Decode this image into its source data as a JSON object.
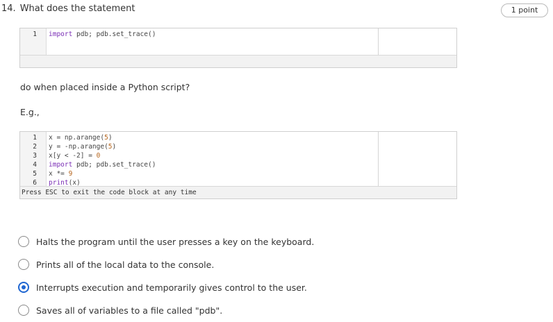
{
  "question": {
    "number": "14.",
    "prompt": "What does the statement",
    "points": "1 point",
    "after_code_text": "do when placed inside a Python script?",
    "example_label": "E.g.,"
  },
  "snippet_one": {
    "lines": [
      {
        "num": "1",
        "kw": "import",
        "rest": " pdb; pdb.set_trace()"
      }
    ]
  },
  "snippet_two": {
    "lines": [
      {
        "num": "1",
        "a": "x = np.arange(",
        "n": "5",
        "b": ")"
      },
      {
        "num": "2",
        "a": "y = -np.arange(",
        "n": "5",
        "b": ")"
      },
      {
        "num": "3",
        "a": "x[y < -2] = ",
        "n": "0",
        "b": ""
      },
      {
        "num": "4",
        "kw": "import",
        "rest": " pdb; pdb.set_trace()"
      },
      {
        "num": "5",
        "a": "x *= ",
        "n": "9",
        "b": ""
      },
      {
        "num": "6",
        "fn": "print",
        "rest": "(x)"
      }
    ],
    "footer": "Press ESC to exit the code block at any time"
  },
  "options": [
    {
      "label": "Halts the program until the user presses a key on the keyboard.",
      "selected": false
    },
    {
      "label": "Prints all of the local data to the console.",
      "selected": false
    },
    {
      "label": "Interrupts execution and temporarily gives control to the user.",
      "selected": true
    },
    {
      "label": "Saves all of variables to a file called \"pdb\".",
      "selected": false
    }
  ],
  "colors": {
    "accent": "#1f66d1",
    "keyword": "#7a2db5",
    "number": "#b5651d"
  }
}
